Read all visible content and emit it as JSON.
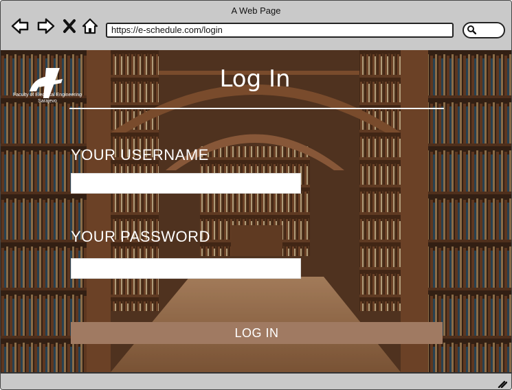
{
  "window": {
    "title": "A Web Page"
  },
  "browser": {
    "url": "https://e-schedule.com/login",
    "icons": [
      "back-arrow-icon",
      "forward-arrow-icon",
      "close-x-icon",
      "home-icon",
      "search-icon"
    ]
  },
  "logo": {
    "caption_line1": "Faculty of Electrical Engineering",
    "caption_line2": "Sarajevo"
  },
  "page": {
    "title": "Log In"
  },
  "form": {
    "username_label": "YOUR USERNAME",
    "username_value": "",
    "password_label": "YOUR PASSWORD",
    "password_value": "",
    "submit_label": "LOG IN"
  },
  "colors": {
    "button": "#a07a62",
    "chrome": "#c9c9c9",
    "text_on_image": "#ffffff"
  }
}
